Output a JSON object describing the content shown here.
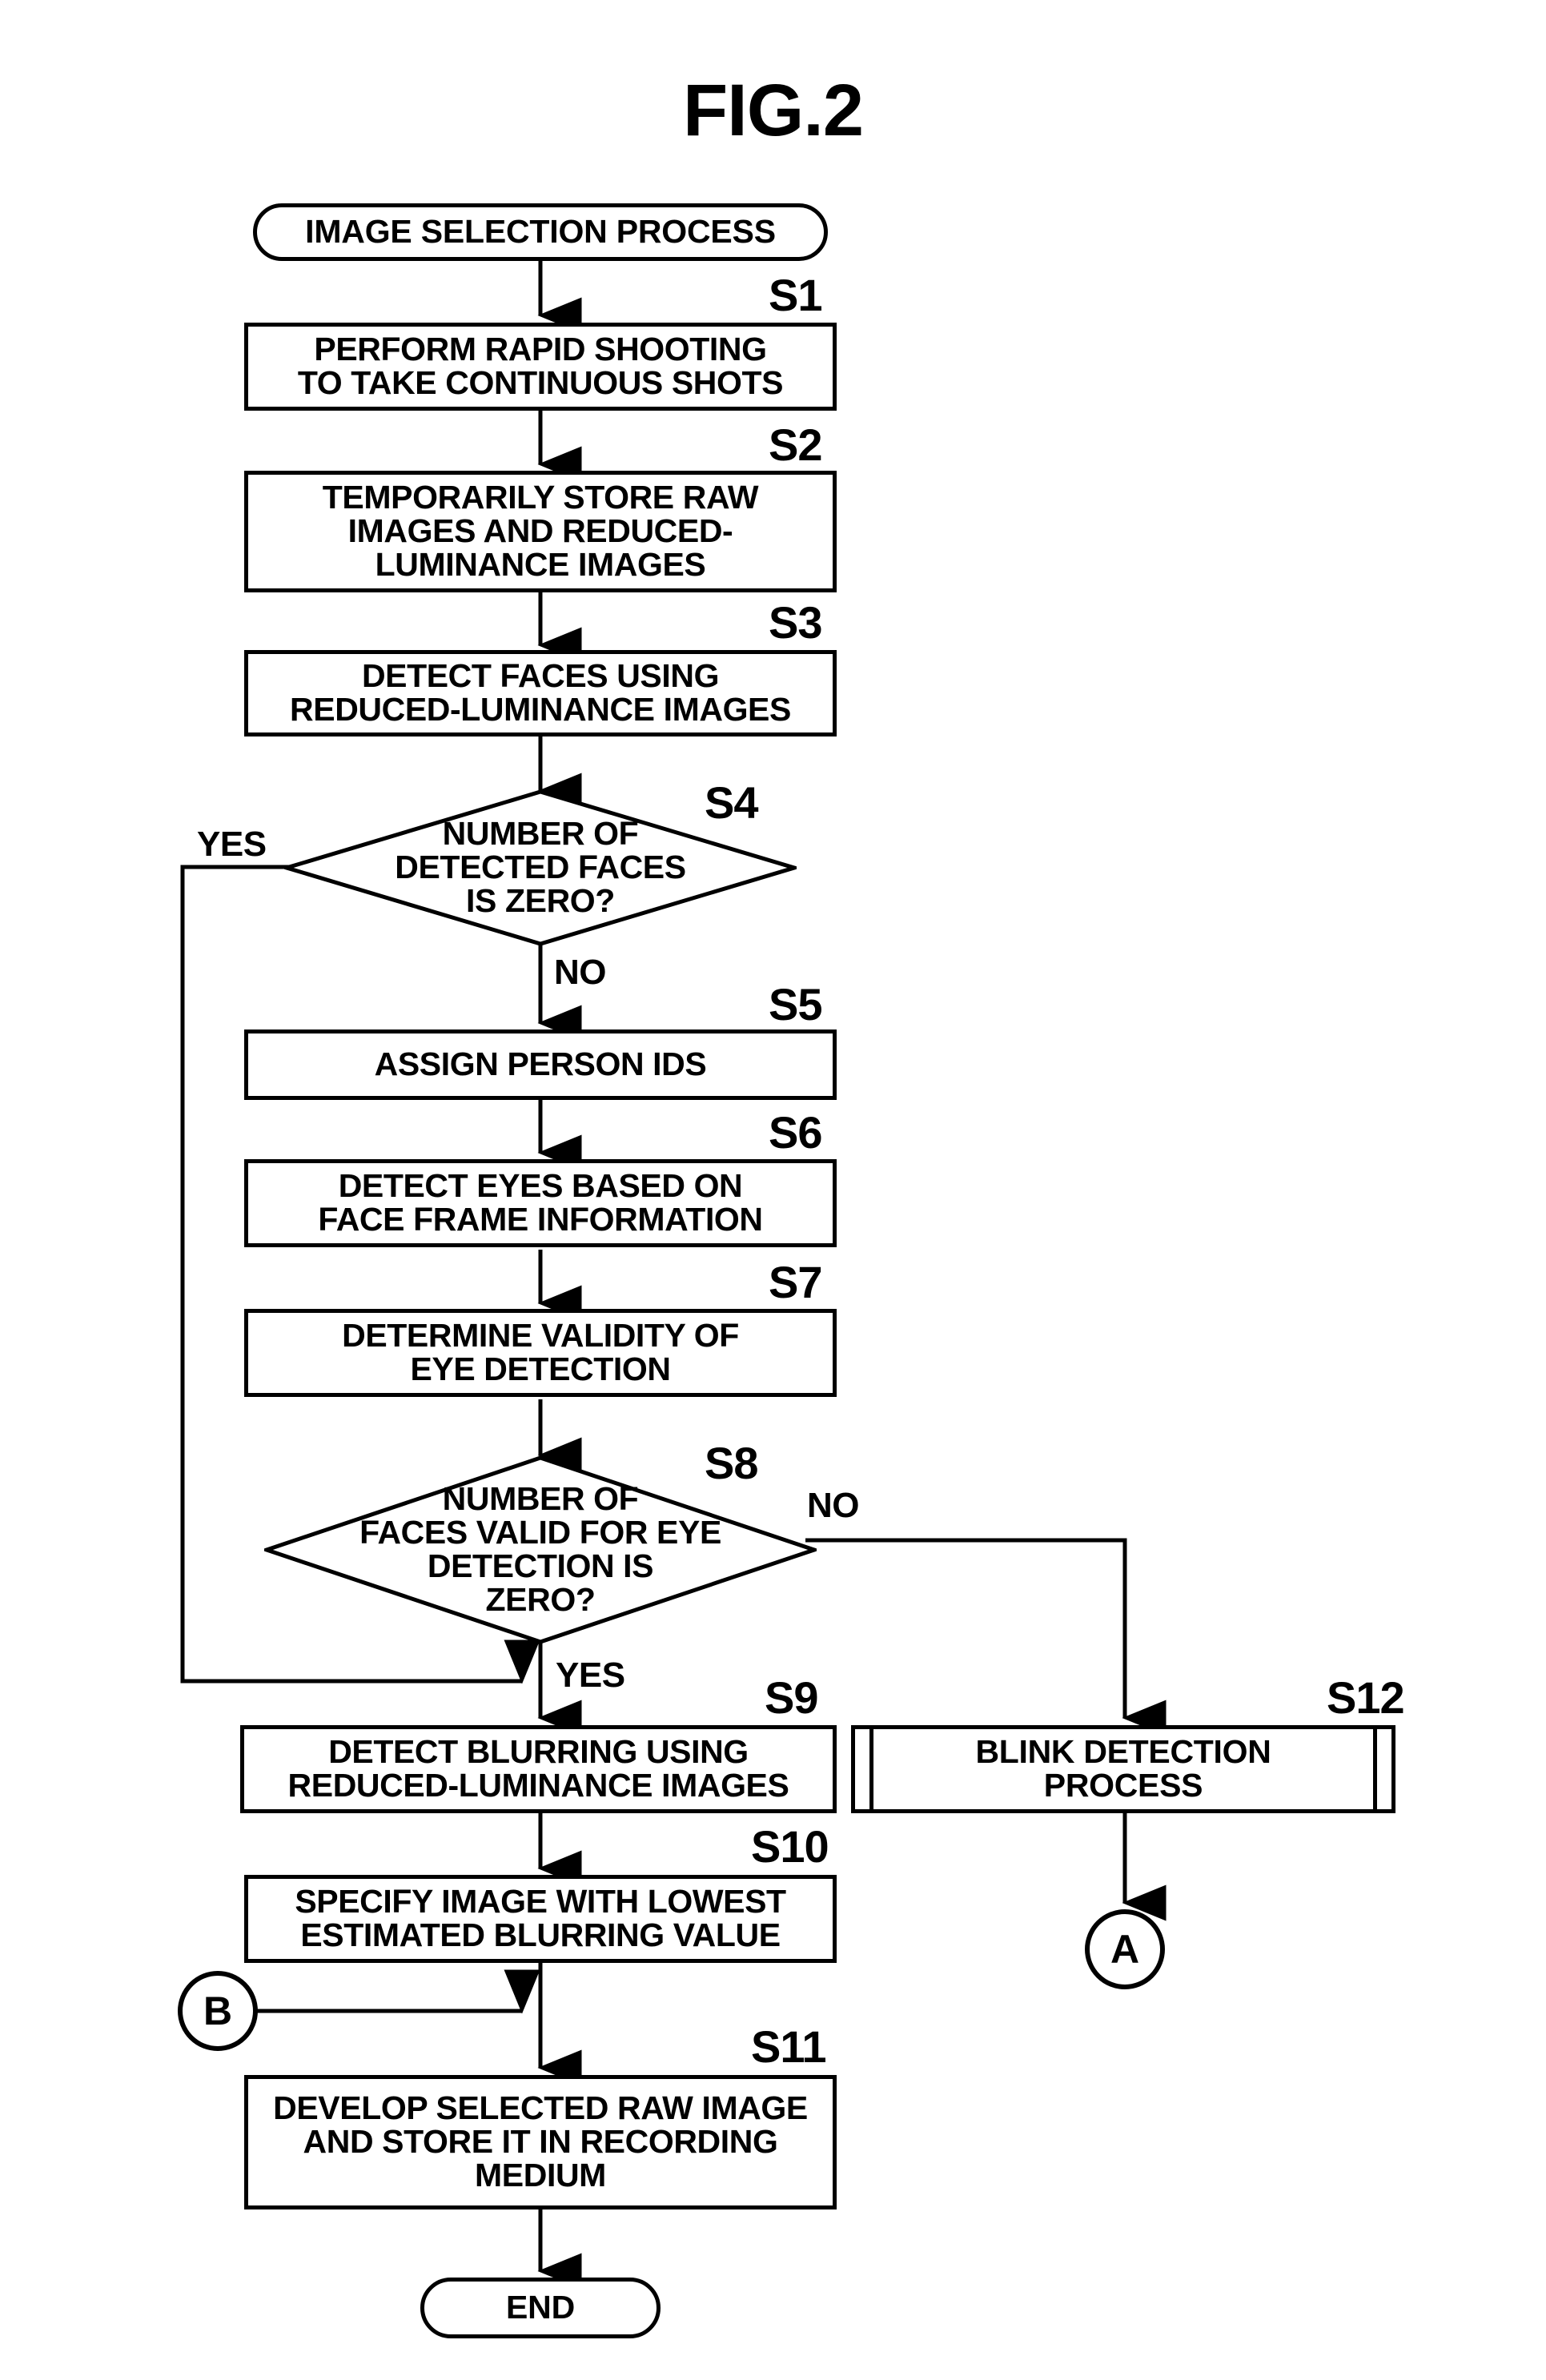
{
  "figure": {
    "title": "FIG.2"
  },
  "flowchart": {
    "type": "flowchart",
    "nodes": [
      {
        "id": "start",
        "shape": "terminator",
        "label": "IMAGE SELECTION PROCESS",
        "step": ""
      },
      {
        "id": "s1",
        "shape": "process",
        "label": "PERFORM RAPID SHOOTING\nTO TAKE CONTINUOUS SHOTS",
        "step": "S1"
      },
      {
        "id": "s2",
        "shape": "process",
        "label": "TEMPORARILY STORE RAW\nIMAGES AND REDUCED-\nLUMINANCE IMAGES",
        "step": "S2"
      },
      {
        "id": "s3",
        "shape": "process",
        "label": "DETECT FACES USING\nREDUCED-LUMINANCE IMAGES",
        "step": "S3"
      },
      {
        "id": "s4",
        "shape": "decision",
        "label": "NUMBER OF\nDETECTED FACES\nIS ZERO?",
        "step": "S4"
      },
      {
        "id": "s5",
        "shape": "process",
        "label": "ASSIGN PERSON IDS",
        "step": "S5"
      },
      {
        "id": "s6",
        "shape": "process",
        "label": "DETECT EYES BASED ON\nFACE FRAME INFORMATION",
        "step": "S6"
      },
      {
        "id": "s7",
        "shape": "process",
        "label": "DETERMINE VALIDITY OF\nEYE DETECTION",
        "step": "S7"
      },
      {
        "id": "s8",
        "shape": "decision",
        "label": "NUMBER OF\nFACES VALID FOR EYE\nDETECTION IS\nZERO?",
        "step": "S8"
      },
      {
        "id": "s9",
        "shape": "process",
        "label": "DETECT BLURRING USING\nREDUCED-LUMINANCE IMAGES",
        "step": "S9"
      },
      {
        "id": "s12",
        "shape": "predefined-process",
        "label": "BLINK DETECTION\nPROCESS",
        "step": "S12"
      },
      {
        "id": "s10",
        "shape": "process",
        "label": "SPECIFY IMAGE WITH LOWEST\nESTIMATED BLURRING VALUE",
        "step": "S10"
      },
      {
        "id": "s11",
        "shape": "process",
        "label": "DEVELOP SELECTED RAW IMAGE\nAND STORE IT IN RECORDING\nMEDIUM",
        "step": "S11"
      },
      {
        "id": "end",
        "shape": "terminator",
        "label": "END",
        "step": ""
      },
      {
        "id": "conn_a",
        "shape": "connector",
        "label": "A",
        "step": ""
      },
      {
        "id": "conn_b",
        "shape": "connector",
        "label": "B",
        "step": ""
      }
    ],
    "branch_labels": {
      "s4_yes": "YES",
      "s4_no": "NO",
      "s8_no": "NO",
      "s8_yes": "YES"
    },
    "edges": [
      {
        "from": "start",
        "to": "s1",
        "label": ""
      },
      {
        "from": "s1",
        "to": "s2",
        "label": ""
      },
      {
        "from": "s2",
        "to": "s3",
        "label": ""
      },
      {
        "from": "s3",
        "to": "s4",
        "label": ""
      },
      {
        "from": "s4",
        "to": "s9",
        "label": "YES"
      },
      {
        "from": "s4",
        "to": "s5",
        "label": "NO"
      },
      {
        "from": "s5",
        "to": "s6",
        "label": ""
      },
      {
        "from": "s6",
        "to": "s7",
        "label": ""
      },
      {
        "from": "s7",
        "to": "s8",
        "label": ""
      },
      {
        "from": "s8",
        "to": "s12",
        "label": "NO"
      },
      {
        "from": "s8",
        "to": "s9",
        "label": "YES"
      },
      {
        "from": "s9",
        "to": "s10",
        "label": ""
      },
      {
        "from": "s12",
        "to": "conn_a",
        "label": ""
      },
      {
        "from": "s10",
        "to": "s11",
        "label": ""
      },
      {
        "from": "conn_b",
        "to": "s11",
        "label": ""
      },
      {
        "from": "s11",
        "to": "end",
        "label": ""
      }
    ],
    "colors": {
      "stroke": "#000000",
      "fill": "#ffffff",
      "text": "#000000"
    }
  }
}
